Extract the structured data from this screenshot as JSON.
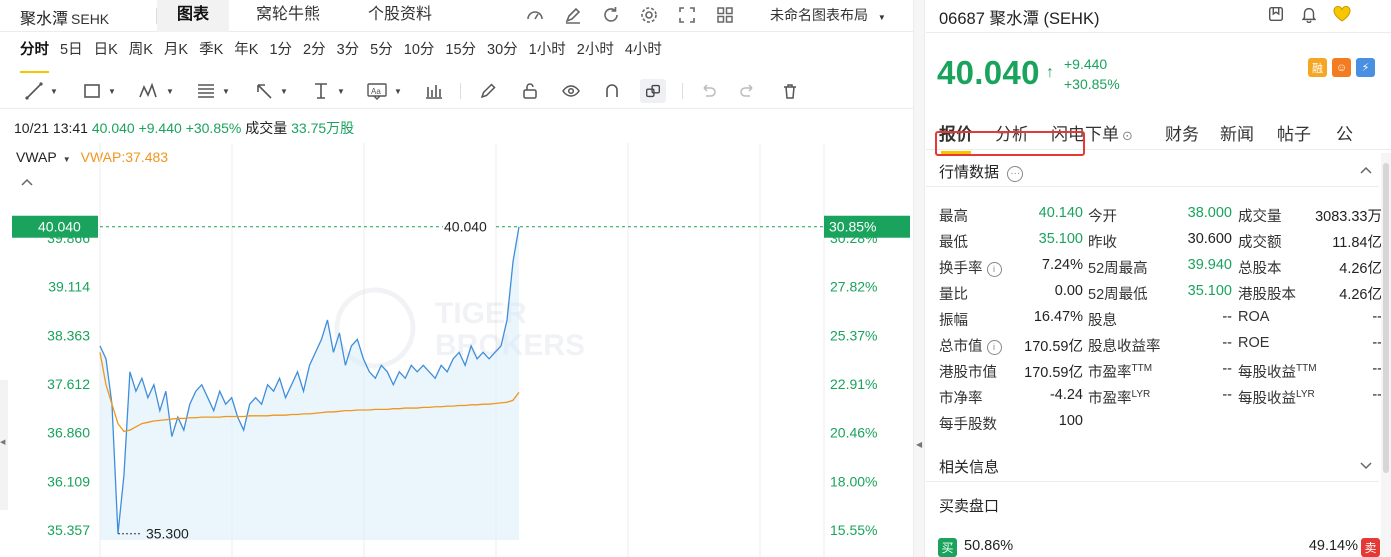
{
  "header": {
    "symbol": "聚水潭",
    "exchange": "SEHK",
    "tabs": [
      "图表",
      "窝轮牛熊",
      "个股资料"
    ],
    "active_tab": 0,
    "layout_name": "未命名图表布局",
    "icons": [
      "gauge-icon",
      "edit-icon",
      "refresh-icon",
      "settings-icon",
      "fullscreen-icon",
      "grid-layout-icon"
    ]
  },
  "periods": {
    "items": [
      "分时",
      "5日",
      "日K",
      "周K",
      "月K",
      "季K",
      "年K",
      "1分",
      "2分",
      "3分",
      "5分",
      "10分",
      "15分",
      "30分",
      "1小时",
      "2小时",
      "4小时"
    ],
    "active": 0
  },
  "tools": {
    "icons": [
      "trend-line-icon",
      "rectangle-icon",
      "pattern-icon",
      "fib-icon",
      "arrow-icon",
      "text-tool-icon",
      "annotation-icon",
      "indicator-icon",
      "pen-icon",
      "lock-icon",
      "eye-icon",
      "magnet-icon",
      "link-icon",
      "undo-icon",
      "redo-icon",
      "trash-icon"
    ]
  },
  "info": {
    "datetime": "10/21 13:41",
    "price": "40.040",
    "change": "+9.440",
    "change_pct": "+30.85%",
    "volume_label": "成交量",
    "volume": "33.75万股"
  },
  "vwap": {
    "label": "VWAP",
    "value_text": "VWAP:37.483"
  },
  "chart_data": {
    "type": "line",
    "y_left_ticks": [
      "39.866",
      "39.114",
      "38.363",
      "37.612",
      "36.860",
      "36.109",
      "35.357"
    ],
    "y_right_ticks": [
      "30.28%",
      "27.82%",
      "25.37%",
      "22.91%",
      "20.46%",
      "18.00%",
      "15.55%"
    ],
    "current_price_label": "40.040",
    "current_pct_label": "30.85%",
    "high_marker": "40.040",
    "low_marker": "35.300",
    "ylim": [
      35.357,
      39.866
    ],
    "x": [
      0,
      2,
      4,
      6,
      8,
      10,
      12,
      14,
      16,
      18,
      20,
      22,
      24,
      26,
      28,
      30,
      32,
      34,
      36,
      38,
      40,
      42,
      44,
      46,
      48,
      50,
      52,
      54,
      56,
      58,
      60,
      62,
      64,
      66,
      68,
      70,
      72,
      74,
      76,
      78,
      80,
      82,
      84,
      86,
      88,
      90,
      92,
      94,
      96,
      98,
      100,
      102,
      104,
      106,
      108,
      110,
      112,
      114,
      116,
      118,
      120,
      122,
      124,
      126,
      128,
      130,
      132,
      134,
      136,
      138,
      140
    ],
    "series": [
      {
        "values": [
          38.2,
          38.0,
          37.3,
          35.3,
          36.2,
          37.8,
          37.5,
          37.7,
          37.4,
          37.6,
          37.2,
          37.5,
          36.8,
          37.1,
          36.9,
          37.3,
          37.5,
          37.6,
          37.4,
          37.2,
          37.5,
          37.3,
          37.4,
          37.1,
          36.9,
          37.3,
          37.4,
          37.3,
          37.6,
          37.5,
          37.7,
          37.4,
          37.6,
          37.8,
          37.5,
          37.9,
          38.1,
          38.3,
          38.6,
          38.1,
          38.4,
          37.9,
          38.2,
          38.3,
          38.0,
          37.8,
          37.7,
          37.9,
          37.8,
          37.6,
          37.8,
          37.7,
          37.9,
          37.8,
          37.9,
          37.8,
          37.7,
          37.9,
          37.8,
          38.0,
          38.1,
          37.9,
          38.2,
          38.0,
          38.1,
          38.0,
          38.1,
          38.2,
          38.6,
          39.5,
          40.04
        ]
      },
      {
        "name": "VWAP",
        "values": [
          38.1,
          37.6,
          37.3,
          37.0,
          36.88,
          36.9,
          36.95,
          37.0,
          37.02,
          37.04,
          37.05,
          37.06,
          37.07,
          37.08,
          37.08,
          37.09,
          37.09,
          37.1,
          37.1,
          37.1,
          37.1,
          37.11,
          37.11,
          37.11,
          37.11,
          37.12,
          37.12,
          37.12,
          37.12,
          37.13,
          37.13,
          37.13,
          37.14,
          37.14,
          37.15,
          37.15,
          37.16,
          37.17,
          37.18,
          37.18,
          37.19,
          37.2,
          37.2,
          37.21,
          37.21,
          37.21,
          37.22,
          37.22,
          37.22,
          37.23,
          37.23,
          37.24,
          37.24,
          37.24,
          37.25,
          37.25,
          37.26,
          37.26,
          37.27,
          37.27,
          37.28,
          37.28,
          37.29,
          37.29,
          37.3,
          37.3,
          37.31,
          37.32,
          37.33,
          37.36,
          37.483
        ]
      }
    ],
    "colors": {
      "line": "#3f8edb",
      "vwap": "#f0961d",
      "up": "#1aa35c",
      "fill": "#d9ecfa"
    },
    "grid": true
  },
  "right": {
    "code": "06687 聚水潭 (SEHK)",
    "price": "40.040",
    "change": "+9.440",
    "change_pct": "+30.85%",
    "badges": [
      {
        "text": "融",
        "color": "#f5a623"
      },
      {
        "text": "☺",
        "color": "#f47c20"
      },
      {
        "text": "⚡",
        "color": "#4a90e2"
      }
    ],
    "tabs": [
      "报价",
      "分析",
      "闪电下单",
      "财务",
      "新闻",
      "帖子",
      "公"
    ],
    "active_tab": 0,
    "section_market": "行情数据",
    "section_related": "相关信息",
    "section_orders": "买卖盘口",
    "quote": [
      [
        {
          "l": "最高",
          "v": "40.140",
          "g": true
        },
        {
          "l": "今开",
          "v": "38.000",
          "g": true
        },
        {
          "l": "成交量",
          "v": "3083.33万"
        }
      ],
      [
        {
          "l": "最低",
          "v": "35.100",
          "g": true
        },
        {
          "l": "昨收",
          "v": "30.600"
        },
        {
          "l": "成交额",
          "v": "11.84亿"
        }
      ],
      [
        {
          "l": "换手率",
          "v": "7.24%",
          "info": true
        },
        {
          "l": "52周最高",
          "v": "39.940",
          "g": true
        },
        {
          "l": "总股本",
          "v": "4.26亿"
        }
      ],
      [
        {
          "l": "量比",
          "v": "0.00"
        },
        {
          "l": "52周最低",
          "v": "35.100",
          "g": true
        },
        {
          "l": "港股股本",
          "v": "4.26亿"
        }
      ],
      [
        {
          "l": "振幅",
          "v": "16.47%"
        },
        {
          "l": "股息",
          "v": "--"
        },
        {
          "l": "ROA",
          "v": "--"
        }
      ],
      [
        {
          "l": "总市值",
          "v": "170.59亿",
          "info": true
        },
        {
          "l": "股息收益率",
          "v": "--"
        },
        {
          "l": "ROE",
          "v": "--"
        }
      ],
      [
        {
          "l": "港股市值",
          "v": "170.59亿"
        },
        {
          "l": "市盈率",
          "sup": "TTM",
          "v": "--"
        },
        {
          "l": "每股收益",
          "sup": "TTM",
          "v": "--"
        }
      ],
      [
        {
          "l": "市净率",
          "v": "-4.24"
        },
        {
          "l": "市盈率",
          "sup": "LYR",
          "v": "--"
        },
        {
          "l": "每股收益",
          "sup": "LYR",
          "v": "--"
        }
      ],
      [
        {
          "l": "每手股数",
          "v": "100"
        }
      ]
    ],
    "order_ratio": {
      "buy_label": "买",
      "buy_pct": "50.86%",
      "sell_label": "卖",
      "sell_pct": "49.14%"
    }
  }
}
